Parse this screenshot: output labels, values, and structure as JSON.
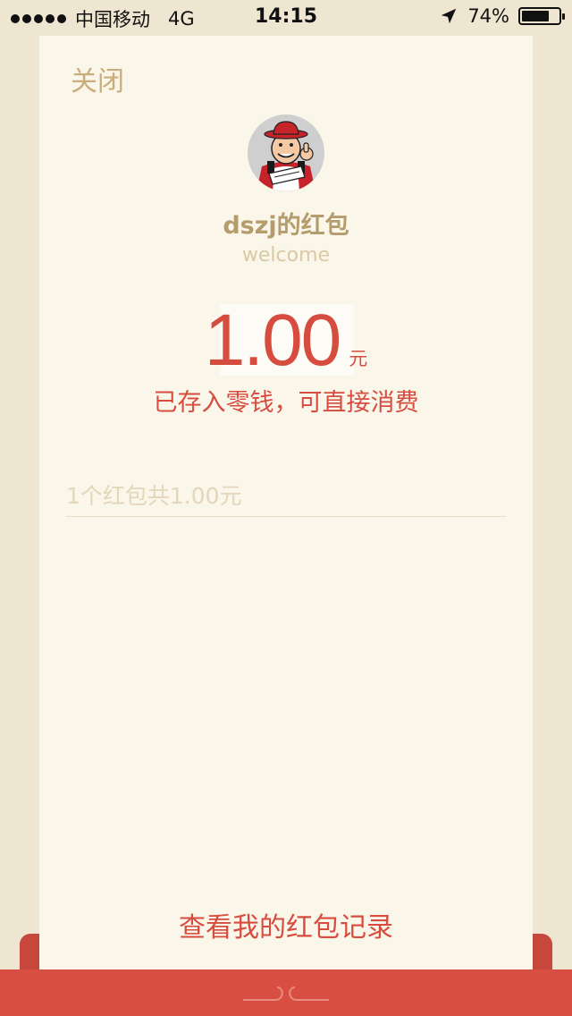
{
  "status_bar": {
    "carrier": "中国移动",
    "network": "4G",
    "time": "14:15",
    "battery": "74%",
    "battery_level": 0.74
  },
  "card": {
    "close_label": "关闭",
    "sender_name": "dszj的红包",
    "greeting": "welcome",
    "amount": "1.00",
    "currency": "元",
    "notice": "已存入零钱，可直接消费",
    "summary": "1个红包共1.00元",
    "records_link": "查看我的红包记录"
  },
  "colors": {
    "accent_red": "#d64d3f",
    "gold": "#b59c6c",
    "card_bg": "#faf6ea",
    "page_bg": "#efe6d2"
  },
  "icons": {
    "signal": "signal-dots-icon",
    "location": "location-arrow-icon",
    "battery": "battery-icon",
    "avatar": "chef-avatar"
  }
}
